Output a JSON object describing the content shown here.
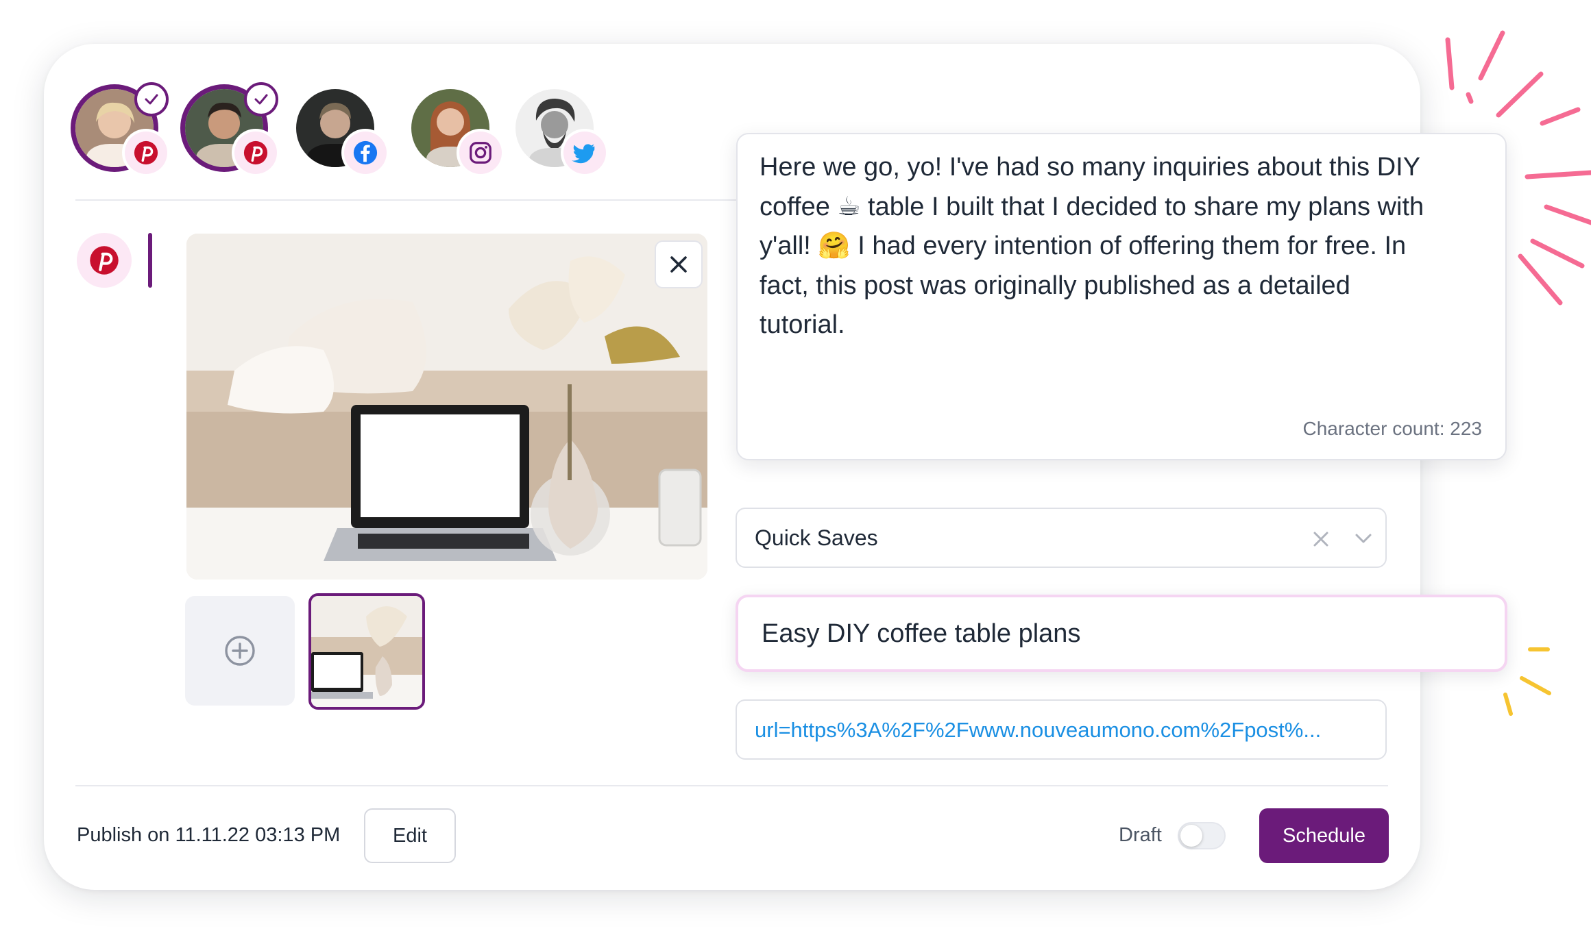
{
  "profiles": [
    {
      "name": "profile-1",
      "network": "pinterest",
      "selected": true
    },
    {
      "name": "profile-2",
      "network": "pinterest",
      "selected": true
    },
    {
      "name": "profile-3",
      "network": "facebook",
      "selected": false
    },
    {
      "name": "profile-4",
      "network": "instagram",
      "selected": false
    },
    {
      "name": "profile-5",
      "network": "twitter",
      "selected": false
    }
  ],
  "active_network": "pinterest",
  "caption": {
    "lines": [
      "Here we go, yo! I've had so many inquiries about this DIY",
      "coffee ☕ table I built that I decided to share my plans with",
      "y'all! 🤗 I had every intention of offering them for free. In",
      "fact, this post was originally published as a detailed",
      "tutorial."
    ],
    "char_count_label": "Character count: 223"
  },
  "board_select": {
    "value": "Quick Saves"
  },
  "pin_title": {
    "value": "Easy DIY coffee table plans"
  },
  "link_field": {
    "value": "url=https%3A%2F%2Fwww.nouveaumono.com%2Fpost%..."
  },
  "footer": {
    "publish_label": "Publish on 11.11.22 03:13 PM",
    "edit_label": "Edit",
    "draft_label": "Draft",
    "draft_enabled": false,
    "schedule_label": "Schedule"
  },
  "colors": {
    "brand": "#6b1b7a",
    "pinterest": "#c8102e",
    "facebook": "#1877f2",
    "twitter": "#1d9bf0",
    "link": "#1a8fe3",
    "decor_pink": "#f56b93",
    "decor_yellow": "#f6c431"
  },
  "icons": [
    "check-icon",
    "pinterest-icon",
    "facebook-icon",
    "instagram-icon",
    "twitter-icon",
    "close-icon",
    "add-circle-icon",
    "clear-icon",
    "chevron-down-icon"
  ]
}
